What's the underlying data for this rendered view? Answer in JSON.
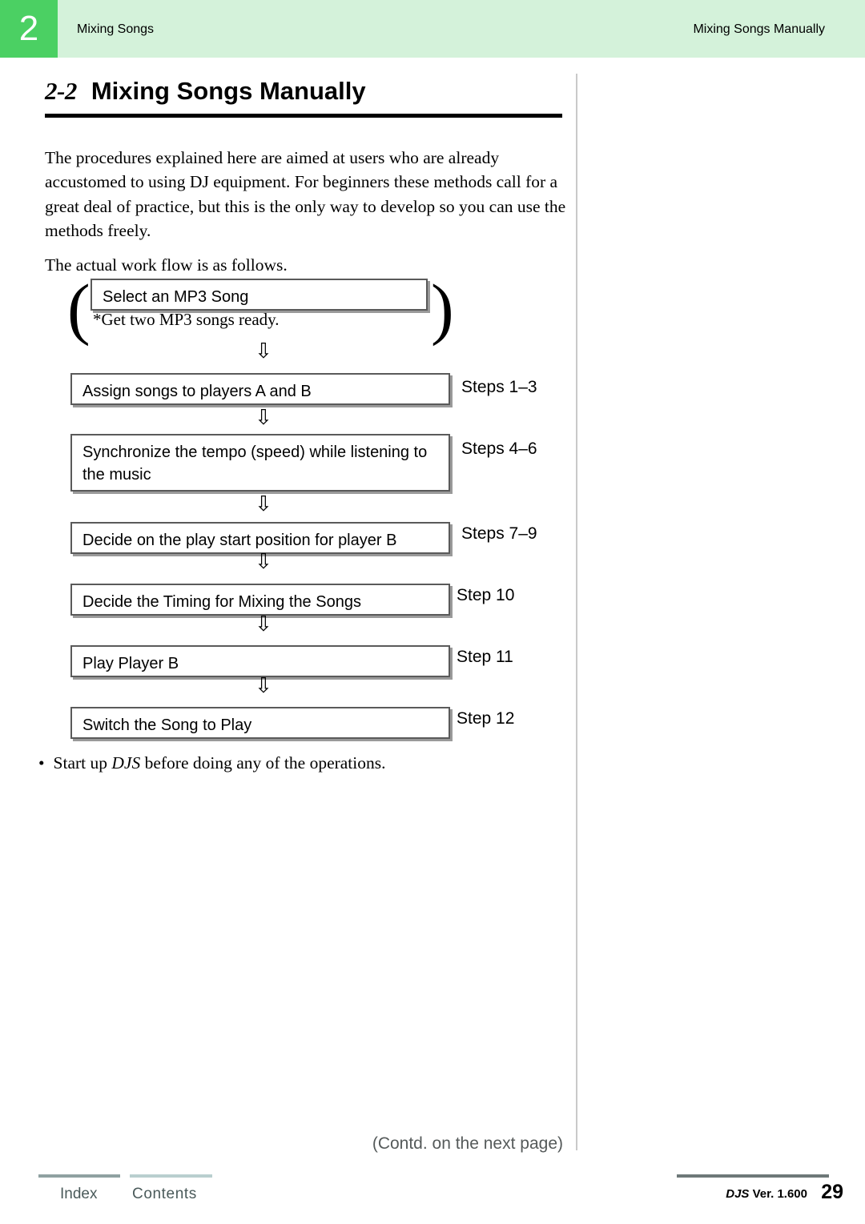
{
  "header": {
    "chapter_number": "2",
    "left_title": "Mixing Songs",
    "right_title": "Mixing Songs Manually"
  },
  "section": {
    "number": "2-2",
    "title": "Mixing Songs Manually",
    "intro_paragraph": "The procedures explained here are aimed at users who are already accustomed to using DJ equipment. For beginners these methods call for a great deal of practice, but this is the only way to develop so you can use the methods freely.",
    "flow_intro": "The actual work flow is as follows."
  },
  "flow": {
    "note_get_two": "*Get two MP3 songs ready.",
    "arrow_glyph": "⇩",
    "boxes": [
      {
        "label": "Select an MP3 Song",
        "steps": ""
      },
      {
        "label": "Assign songs to players A and B",
        "steps": "Steps 1–3"
      },
      {
        "label": "Synchronize the tempo (speed) while listening to the music",
        "steps": "Steps 4–6"
      },
      {
        "label": "Decide on the play start position for player B",
        "steps": "Steps 7–9"
      },
      {
        "label": "Decide the Timing for Mixing the Songs",
        "steps": "Step 10"
      },
      {
        "label": "Play Player B",
        "steps": "Step 11"
      },
      {
        "label": "Switch the Song to Play",
        "steps": "Step 12"
      }
    ]
  },
  "notes": {
    "bullet_marker": "•",
    "bullet_before": "Start up ",
    "bullet_italic": "DJS",
    "bullet_after": " before doing any of the operations."
  },
  "contd_label": "(Contd. on the next page)",
  "footer": {
    "index_label": "Index",
    "contents_label": "Contents",
    "djs_mark": "DJS",
    "version_label": " Ver.  1.600",
    "page_number": "29"
  },
  "colors": {
    "header_band": "#d4f2da",
    "chapter_tab": "#4bd063",
    "box_border": "#5a5a5a",
    "box_shadow": "#9a9a9a",
    "contd_text": "#555a5a"
  }
}
